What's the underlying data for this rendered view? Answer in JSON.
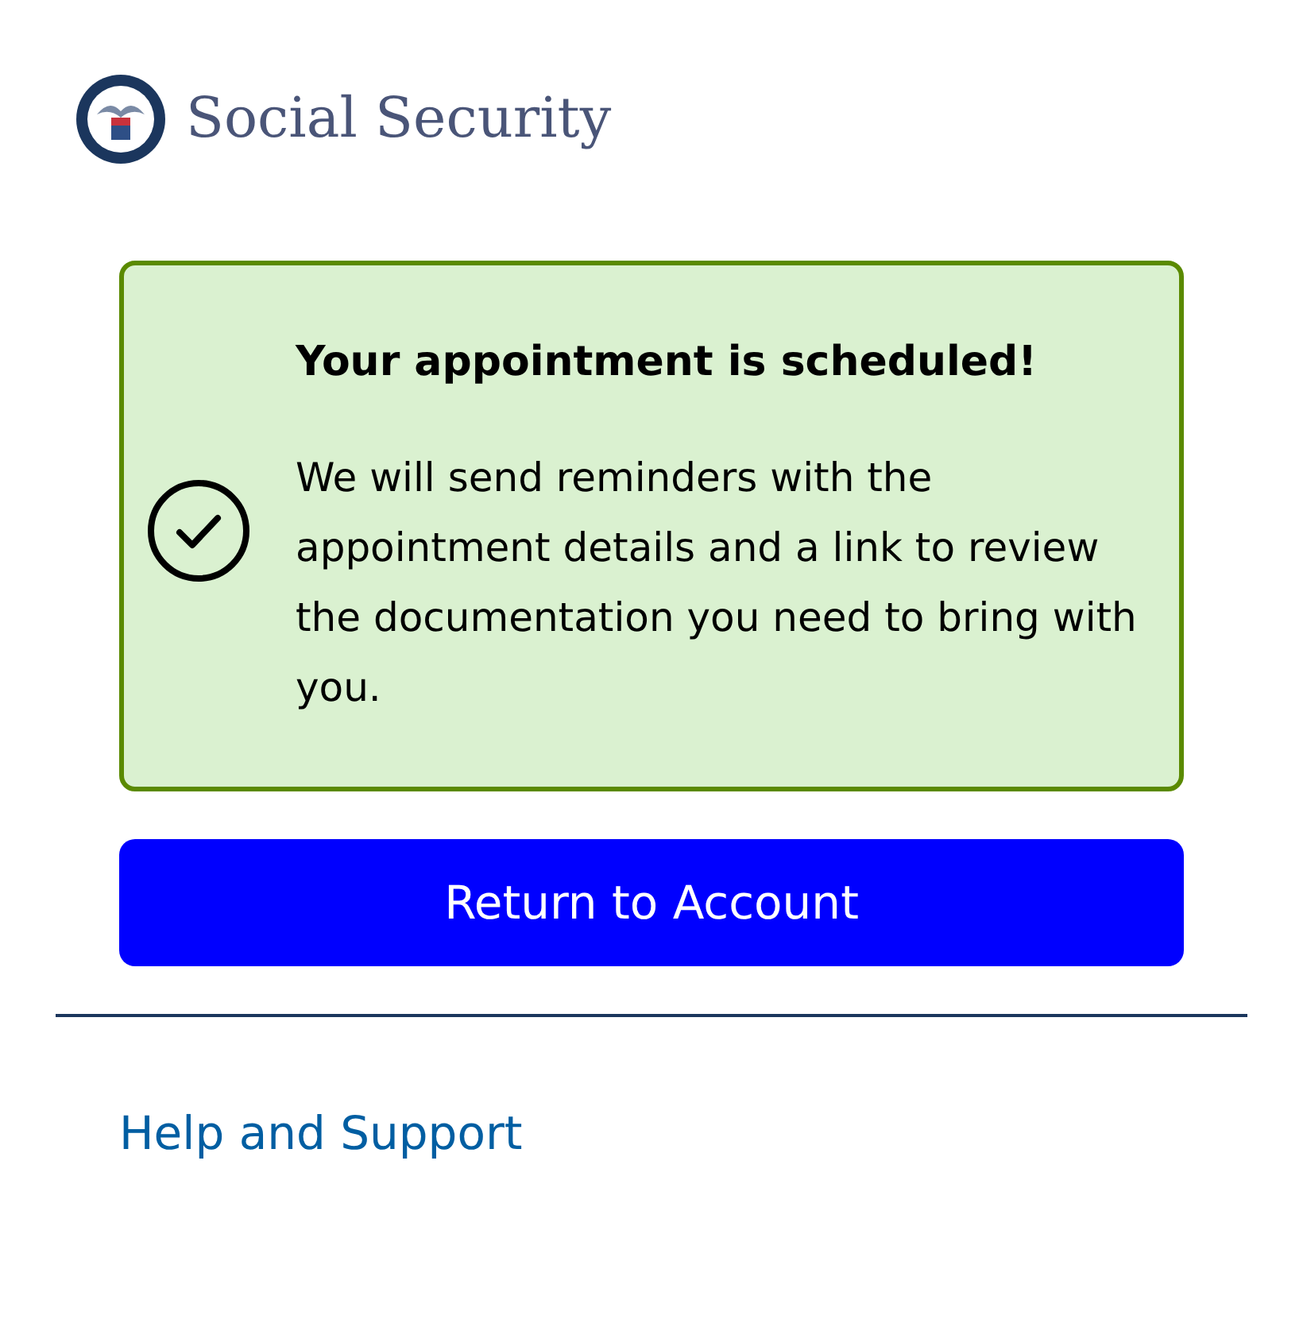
{
  "header": {
    "brand": "Social Security"
  },
  "alert": {
    "kind": "success",
    "title": "Your appointment is scheduled!",
    "body": "We will send reminders with the appointment details and a link to review the documentation you need to bring with you."
  },
  "button": {
    "label": "Return to Account"
  },
  "footer": {
    "link": "Help and Support"
  }
}
